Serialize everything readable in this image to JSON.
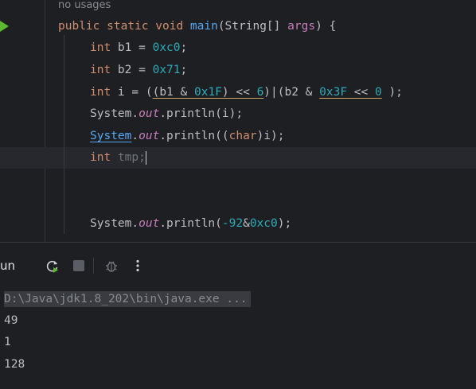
{
  "editor": {
    "hint": "no usages",
    "lines": {
      "l1": {
        "kw": [
          "public",
          "static",
          "void"
        ],
        "fn": "main",
        "open": "(String[] ",
        "param": "args",
        "close": ") {"
      },
      "l2": {
        "kw": "int",
        "name": " b1 = ",
        "num": "0xc0",
        "end": ";"
      },
      "l3": {
        "kw": "int",
        "name": " b2 = ",
        "num": "0x71",
        "end": ";"
      },
      "l4": {
        "kw": "int",
        "a": " i = (",
        "b": "(b1 & ",
        "n1": "0x1F",
        "c": ") << ",
        "n2": "6",
        "d": ")|(b2 & ",
        "n3": "0x3F",
        "e": " << ",
        "n4": "0",
        "f": " );"
      },
      "l5": {
        "a": "System.",
        "out": "out",
        "b": ".println(i);"
      },
      "l6": {
        "sys": "System",
        "a": ".",
        "out": "out",
        "b": ".println((",
        "kw": "char",
        "c": ")i);"
      },
      "l7": {
        "kw": "int",
        "sp": " ",
        "name": "tmp",
        "semi": ";"
      },
      "l8": {
        "a": "System.",
        "out": "out",
        "b": ".println(",
        "n1": "-92",
        "amp": "&",
        "n2": "0xc0",
        "c": ");"
      }
    }
  },
  "toolwindow": {
    "title": "un",
    "buttons": [
      "rerun-icon",
      "stop-icon",
      "debug-icon",
      "more-icon"
    ],
    "console": {
      "command": "D:\\Java\\jdk1.8_202\\bin\\java.exe ...",
      "output": [
        "49",
        "1",
        "128"
      ]
    }
  },
  "colors": {
    "background": "#1e1f22",
    "keyword": "#cf8e6d",
    "number": "#2aacb8",
    "function": "#56a8f5",
    "run_green": "#5fb832"
  }
}
